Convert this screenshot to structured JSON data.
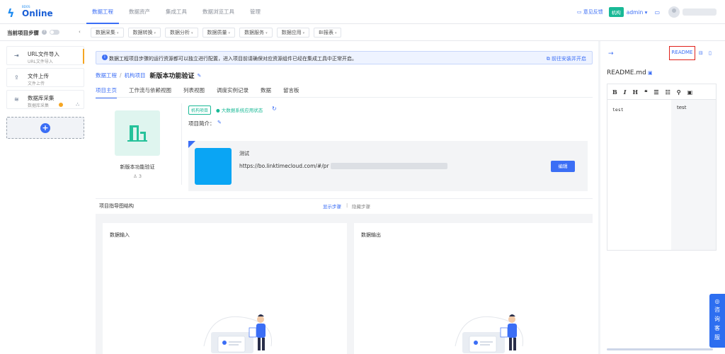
{
  "brand": {
    "sub": "BDOS",
    "name": "Online"
  },
  "topnav": [
    "数据工程",
    "数据资产",
    "集成工具",
    "数据浏览工具",
    "管理"
  ],
  "topright": {
    "feedback": "意见反馈",
    "org_badge": "机构",
    "user": "admin"
  },
  "toolbar": {
    "steps_label": "当前项目步骤",
    "tools": [
      "数据采集",
      "数据转换",
      "数据分析",
      "数据质量",
      "数据服务",
      "数据应用",
      "BI报表"
    ]
  },
  "sources": [
    {
      "title": "URL文件导入",
      "sub": "URL文件导入"
    },
    {
      "title": "文件上传",
      "sub": "文件上传"
    },
    {
      "title": "数据库采集",
      "sub": "数据库采集"
    }
  ],
  "notice": {
    "text": "数据工程项目步骤的运行资源都可以独立进行配置，进入项目前请确保对应资源组件已经在集成工具中正常开启。",
    "link": "前往安装并开启"
  },
  "breadcrumb": {
    "root": "数据工程",
    "parent": "机构项目",
    "current": "新版本功能验证"
  },
  "subtabs": [
    "项目主页",
    "工作流与依赖视图",
    "列表视图",
    "调度实例记录",
    "数据",
    "留言板"
  ],
  "project": {
    "name": "新版本功能验证",
    "members": "3",
    "tag": "机构项目",
    "status": "大数据系统应用状态",
    "intro_label": "项目简介："
  },
  "app": {
    "name": "测试",
    "url_prefix": "https://bo.linktimecloud.com/#/pr",
    "edit_label": "编辑"
  },
  "guide": {
    "title": "项目指导图结构",
    "show_steps": "显示步骤",
    "sep": "|",
    "hide_steps": "隐藏步骤"
  },
  "panes": {
    "input": "数据输入",
    "output": "数据输出"
  },
  "readme": {
    "button": "README",
    "filename": "README.md",
    "toolbar": [
      "B",
      "I",
      "H",
      "❝",
      "☰",
      "☷",
      "⚲",
      "▣"
    ],
    "source": "test",
    "preview": "test"
  },
  "consult": {
    "chars": [
      "咨",
      "询",
      "客",
      "服"
    ]
  },
  "colors": {
    "accent": "#3b6ef5",
    "green": "#19b996",
    "highlight": "#e0201a"
  }
}
